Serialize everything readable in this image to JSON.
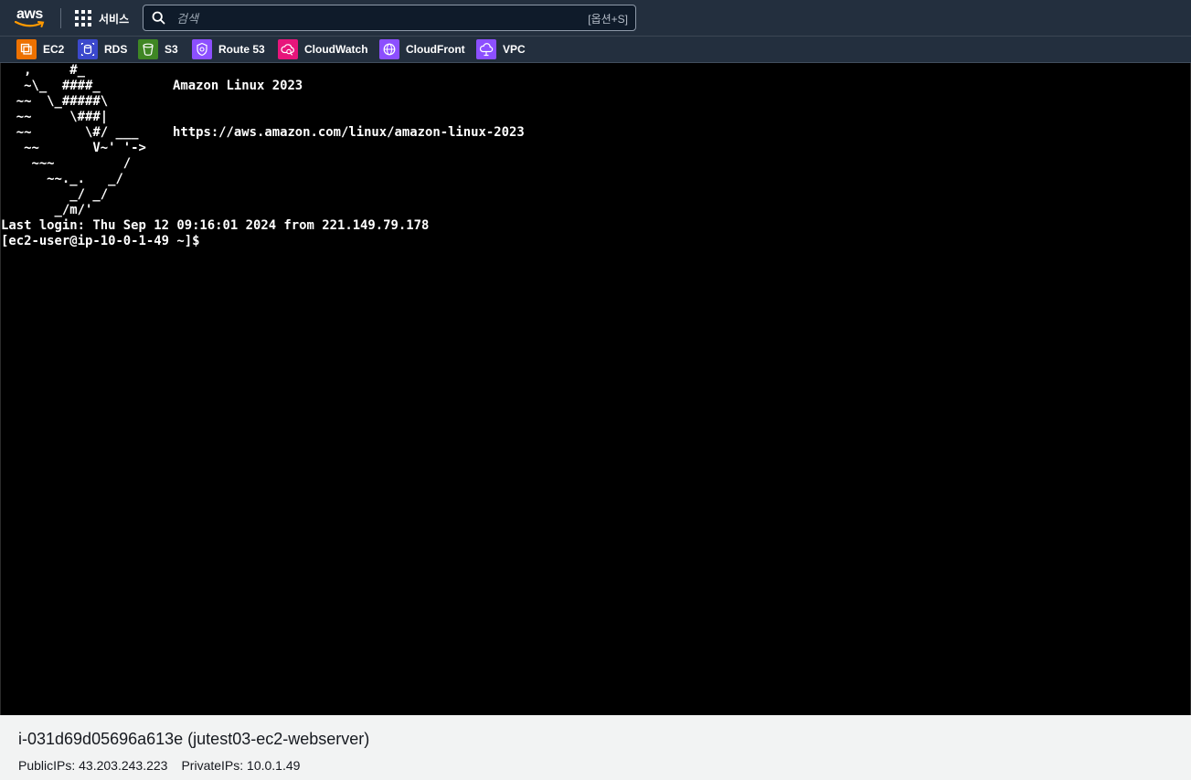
{
  "topnav": {
    "logo_text": "aws",
    "services_label": "서비스",
    "search_placeholder": "검색",
    "search_shortcut": "[옵션+S]"
  },
  "favorites": [
    {
      "label": "EC2",
      "color": "#ed7100",
      "icon": "ec2-icon"
    },
    {
      "label": "RDS",
      "color": "#3b48cc",
      "icon": "rds-icon"
    },
    {
      "label": "S3",
      "color": "#3f8624",
      "icon": "s3-icon"
    },
    {
      "label": "Route 53",
      "color": "#8c4fff",
      "icon": "route53-icon"
    },
    {
      "label": "CloudWatch",
      "color": "#e7157b",
      "icon": "cloudwatch-icon"
    },
    {
      "label": "CloudFront",
      "color": "#8c4fff",
      "icon": "cloudfront-icon"
    },
    {
      "label": "VPC",
      "color": "#8c4fff",
      "icon": "vpc-icon"
    }
  ],
  "terminal": {
    "ascii_art": [
      "   ,     #_",
      "   ~\\_  ####_",
      "  ~~  \\_#####\\",
      "  ~~     \\###|",
      "  ~~       \\#/ ___",
      "   ~~       V~' '->",
      "    ~~~         /",
      "      ~~._.   _/",
      "         _/ _/",
      "       _/m/'"
    ],
    "os_name": "Amazon Linux 2023",
    "os_url": "https://aws.amazon.com/linux/amazon-linux-2023",
    "last_login": "Last login: Thu Sep 12 09:16:01 2024 from 221.149.79.178",
    "prompt": "[ec2-user@ip-10-0-1-49 ~]$"
  },
  "instance": {
    "title": "i-031d69d05696a613e (jutest03-ec2-webserver)",
    "public_ips": "PublicIPs: 43.203.243.223",
    "private_ips": "PrivateIPs: 10.0.1.49"
  }
}
